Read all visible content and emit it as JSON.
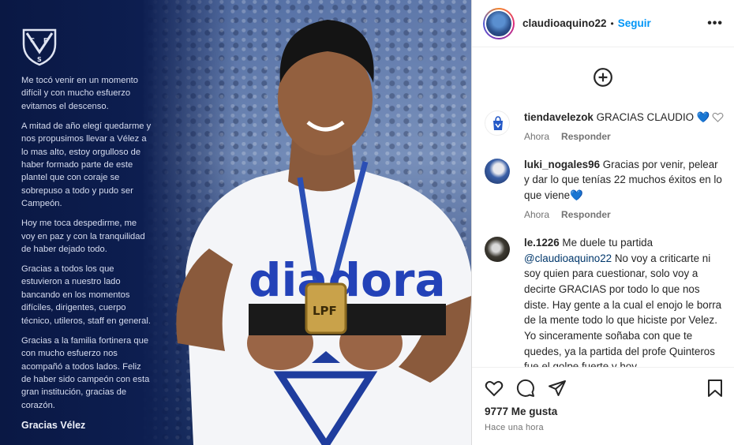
{
  "post": {
    "caption": [
      "Me tocó venir en un momento difícil y con mucho esfuerzo evitamos el descenso.",
      "A mitad de año elegí quedarme y nos propusimos llevar a Vélez a lo mas alto, estoy orgulloso de haber formado parte de este plantel que con coraje se sobrepuso a todo y pudo ser Campeón.",
      "Hoy me toca despedirme, me voy en paz y con la tranquilidad de haber dejado todo.",
      "Gracias a todos los que estuvieron a nuestro lado bancando en los momentos difíciles, dirigentes, cuerpo técnico, utileros, staff en general.",
      "Gracias a la familia fortinera que con mucho esfuerzo nos acompañó a todos lados. Feliz de haber sido campeón con esta gran institución, gracias de corazón."
    ],
    "signature": "Gracias Vélez",
    "shirt_brand": "diadora",
    "medal_text": "LPF"
  },
  "header": {
    "username": "claudioaquino22",
    "separator": "•",
    "follow_label": "Seguir",
    "more_icon": "more-horizontal-icon"
  },
  "comments": [
    {
      "username": "tiendavelezok",
      "text": "GRACIAS CLAUDIO 💙",
      "time": "Ahora",
      "reply": "Responder"
    },
    {
      "username": "luki_nogales96",
      "text": "Gracias por venir, pelear y dar lo que tenías 22 muchos éxitos en lo que viene💙",
      "time": "Ahora",
      "reply": "Responder"
    },
    {
      "username": "le.1226",
      "text_before": "Me duele tu partida",
      "mention": "@claudioaquino22",
      "text_after": "No voy a criticarte ni soy quien para cuestionar, solo voy a decirte GRACIAS por todo lo que nos diste. Hay gente a la cual el enojo le borra de la mente todo lo que hiciste por Velez. Yo sinceramente soñaba con que te quedes, ya la partida del profe Quinteros fue el golpe fuerte y hoy"
    }
  ],
  "footer": {
    "likes": "9777 Me gusta",
    "time": "Hace una hora"
  },
  "colors": {
    "follow": "#0095f6",
    "heart_blue": "#2f6fd6",
    "mention": "#00376b",
    "velez_blue": "#1f3d9e"
  }
}
